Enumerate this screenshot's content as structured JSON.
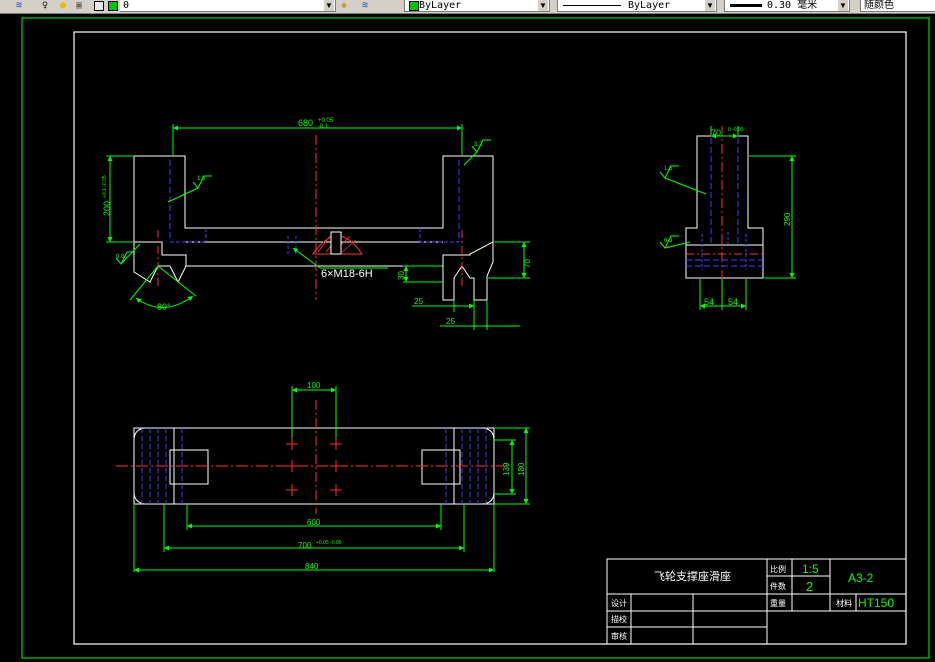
{
  "toolbar": {
    "layer_value": "0",
    "color_value": "ByLayer",
    "linetype_value": "ByLayer",
    "lineweight_value": "0.30 毫米",
    "plotstyle_value": "随颜色"
  },
  "drawing": {
    "front_view": {
      "top_dim": "680",
      "top_dim_tol_upper": "+0.05",
      "top_dim_tol_lower": "-0.1",
      "left_height_dim": "200",
      "left_height_tol": "+0.1 -0.05",
      "roughness_left": "1.6",
      "roughness_right": "3.2",
      "roughness_vee": "0.8",
      "thread_label": "6×M18-6H",
      "dim_30": "30",
      "dim_70": "70",
      "dim_25_a": "25",
      "dim_25_b": "25",
      "angle_label": "80°"
    },
    "side_view": {
      "top_dim": "70",
      "top_dim_tol": "0 -0.05",
      "height_dim": "290",
      "roughness_upper": "1.6",
      "roughness_lower": "6.3",
      "dim_54_left": "54",
      "dim_54_right": "54"
    },
    "top_view": {
      "dim_100": "100",
      "dim_139": "139",
      "dim_180": "180",
      "dim_600": "600",
      "dim_700": "700",
      "dim_700_tol": "+0.05 -0.05",
      "dim_840": "840"
    },
    "title_block": {
      "part_name": "飞轮支撑座滑座",
      "scale_label": "比例",
      "scale_value": "1:5",
      "qty_label": "件数",
      "qty_value": "2",
      "drawing_no": "A3-2",
      "weight_label": "重量",
      "material_label": "材料",
      "material_value": "HT150",
      "designer_label": "设计",
      "checker_label": "描校",
      "reviewer_label": "审核"
    }
  }
}
